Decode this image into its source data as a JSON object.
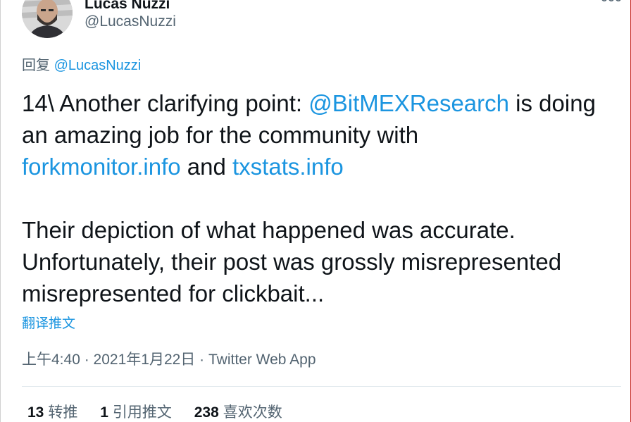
{
  "author": {
    "display_name": "Lucas Nuzzi",
    "handle": "@LucasNuzzi"
  },
  "more_icon": "more-dots-icon",
  "reply": {
    "prefix": "回复",
    "mention": "@LucasNuzzi"
  },
  "tweet": {
    "p1_text1": "14\\ Another clarifying point: ",
    "p1_mention": "@BitMEXResearch",
    "p1_text2": " is doing",
    "p1_line2": "an amazing job for the community with",
    "p1_link1": "forkmonitor.info",
    "p1_and": " and ",
    "p1_link2": "txstats.info",
    "p2_line1": "Their depiction of what happened was accurate.",
    "p2_line2": "Unfortunately, their post was grossly misrepresented",
    "p2_line3": "misrepresented for clickbait..."
  },
  "translate_label": "翻译推文",
  "meta": {
    "time": "上午4:40",
    "separator": " · ",
    "date": "2021年1月22日",
    "app": "Twitter Web App"
  },
  "stats": {
    "retweets_count": "13",
    "retweets_label": "转推",
    "quotes_count": "1",
    "quotes_label": "引用推文",
    "likes_count": "238",
    "likes_label": "喜欢次数"
  },
  "colors": {
    "link": "#1b95e0",
    "secondary_text": "#536471",
    "primary_text": "#0f1419",
    "divider": "#e1e8ed"
  }
}
